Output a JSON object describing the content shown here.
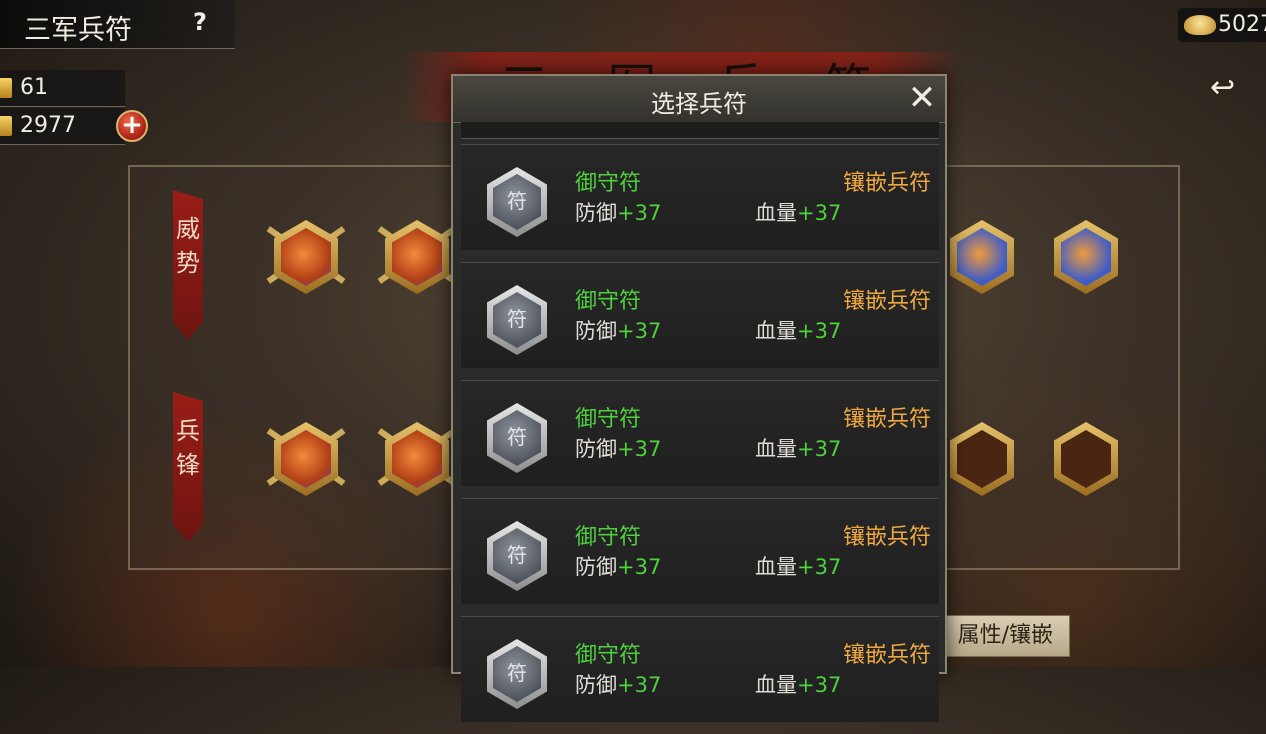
{
  "header": {
    "title": "三军兵符",
    "help": "?"
  },
  "resources": {
    "stamina": "61",
    "tokens": "2977",
    "add": "+",
    "gold": "5027"
  },
  "back": {
    "label": "↩"
  },
  "banner": {
    "text": "三军兵符"
  },
  "rows": [
    {
      "tag": "威势"
    },
    {
      "tag": "兵锋"
    }
  ],
  "attr_tab": {
    "label": "属性/镶嵌"
  },
  "modal": {
    "title": "选择兵符",
    "close": "✕",
    "items": [
      {
        "name": "御守符",
        "action": "镶嵌兵符",
        "stat1_label": "防御",
        "stat1_value": "+37",
        "stat2_label": "血量",
        "stat2_value": "+37",
        "glyph": "符"
      },
      {
        "name": "御守符",
        "action": "镶嵌兵符",
        "stat1_label": "防御",
        "stat1_value": "+37",
        "stat2_label": "血量",
        "stat2_value": "+37",
        "glyph": "符"
      },
      {
        "name": "御守符",
        "action": "镶嵌兵符",
        "stat1_label": "防御",
        "stat1_value": "+37",
        "stat2_label": "血量",
        "stat2_value": "+37",
        "glyph": "符"
      },
      {
        "name": "御守符",
        "action": "镶嵌兵符",
        "stat1_label": "防御",
        "stat1_value": "+37",
        "stat2_label": "血量",
        "stat2_value": "+37",
        "glyph": "符"
      },
      {
        "name": "御守符",
        "action": "镶嵌兵符",
        "stat1_label": "防御",
        "stat1_value": "+37",
        "stat2_label": "血量",
        "stat2_value": "+37",
        "glyph": "符"
      }
    ]
  },
  "colors": {
    "accent_green": "#4fd13e",
    "accent_orange": "#f0a840",
    "banner_red": "#9a1d17"
  }
}
